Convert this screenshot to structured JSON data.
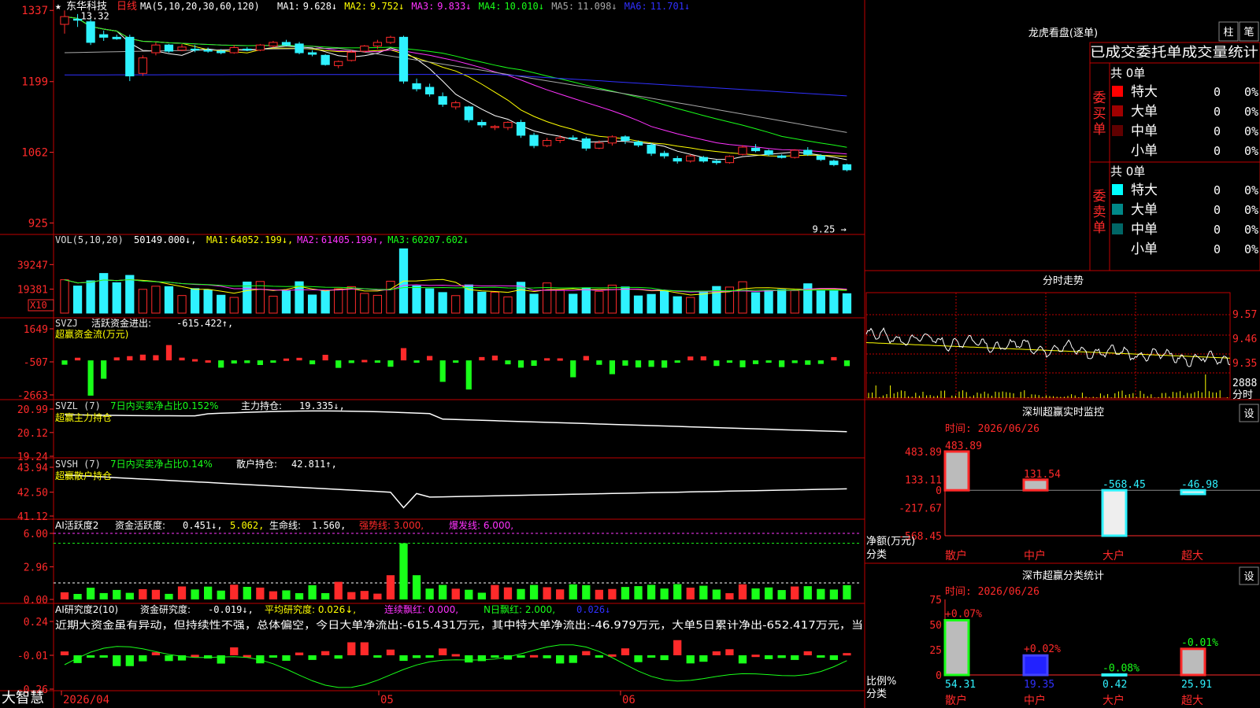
{
  "app": {
    "brand": "大智慧",
    "stock_name": "东华科技",
    "period": "日线",
    "star": "★"
  },
  "colors": {
    "up": "#ff2a2a",
    "down": "#2ff2ff",
    "green": "#19ff19",
    "yellow": "#ffff00",
    "magenta": "#ff33ff",
    "white": "#ffffff",
    "gray": "#a8a8a8",
    "blue": "#3030ff",
    "red_border": "#c00000"
  },
  "main_chart": {
    "yaxis": [
      "13.37",
      "11.99",
      "10.62",
      "9.25"
    ],
    "ylim": [
      9.15,
      13.45
    ],
    "ma_label": "MA(5,10,20,30,60,120)",
    "mas": [
      {
        "label": "MA1:",
        "value": "9.628↓",
        "color": "#ffffff"
      },
      {
        "label": "MA2:",
        "value": "9.752↓",
        "color": "#ffff00"
      },
      {
        "label": "MA3:",
        "value": "9.833↓",
        "color": "#ff33ff"
      },
      {
        "label": "MA4:",
        "value": "10.010↓",
        "color": "#19ff19"
      },
      {
        "label": "MA5:",
        "value": "11.098↓",
        "color": "#a8a8a8"
      },
      {
        "label": "MA6:",
        "value": "11.701↓",
        "color": "#3030ff"
      }
    ],
    "high_label": "13.32",
    "low_label": "9.25"
  },
  "vol_panel": {
    "title": "VOL(5,10,20)",
    "value": "50149.000↓,",
    "mas": [
      {
        "label": "MA1:",
        "value": "64052.199↓,",
        "color": "#ffff00"
      },
      {
        "label": "MA2:",
        "value": "61405.199↑,",
        "color": "#ff33ff"
      },
      {
        "label": "MA3:",
        "value": "60207.602↓",
        "color": "#19ff19"
      }
    ],
    "yaxis": [
      "39247",
      "19381"
    ],
    "unit": "X10"
  },
  "svzj_panel": {
    "title": "SVZJ",
    "label": "活跃资金进出:",
    "value": "-615.422↑,",
    "subtitle": "超赢资金流(万元)",
    "yaxis": [
      "1649",
      "-507",
      "-2663"
    ]
  },
  "svzl_panel": {
    "title": "SVZL (7)",
    "label1": "7日内买卖净占比0.152%",
    "label2": "主力持仓:",
    "value": "19.335↓,",
    "subtitle": "超赢主力持仓",
    "yaxis": [
      "20.99",
      "20.12",
      "19.24"
    ]
  },
  "svsh_panel": {
    "title": "SVSH (7)",
    "label1": "7日内买卖净占比0.14%",
    "label2": "散户持仓:",
    "value": "42.811↑,",
    "subtitle": "超赢散户持仓",
    "yaxis": [
      "43.94",
      "42.50",
      "41.12"
    ]
  },
  "ai_active_panel": {
    "title": "AI活跃度2",
    "label1": "资金活跃度:",
    "value1": "0.451↓,",
    "value2": "5.062,",
    "label3": "生命线:",
    "value3": "1.560,",
    "label4": "强势线: 3.000,",
    "label5": "爆发线: 6.000,",
    "yaxis": [
      "6.00",
      "2.96",
      "0.00"
    ]
  },
  "ai_research_panel": {
    "title": "AI研究度2(10)",
    "label1": "资金研究度:",
    "value1": "-0.019↓,",
    "label2": "平均研究度: 0.026↓,",
    "label3": "连续飘红: 0.000,",
    "label4": "N日飘红: 2.000,",
    "value4": "0.026↓",
    "commentary": "近期大资金虽有异动，但持续性不强，总体偏空，今日大单净流出:-615.431万元，其中特大单净流出:-46.979万元，大单5日累计净出-652.417万元，当",
    "yaxis": [
      "0.24",
      "-0.01",
      "-0.26"
    ]
  },
  "xaxis": [
    "2026/04",
    "05",
    "06"
  ],
  "dragon_tiger": {
    "title": "龙虎看盘(逐单)",
    "btn1": "柱",
    "btn2": "笔",
    "header": "已成交委托单成交量统计",
    "buy_label": "委买单",
    "sell_label": "委卖单",
    "buy_total": "共 0单",
    "sell_total": "共 0单",
    "buy_rows": [
      {
        "name": "特大",
        "count": "0",
        "pct": "0%",
        "color": "#ff0000"
      },
      {
        "name": "大单",
        "count": "0",
        "pct": "0%",
        "color": "#a00000"
      },
      {
        "name": "中单",
        "count": "0",
        "pct": "0%",
        "color": "#600000"
      },
      {
        "name": "小单",
        "count": "0",
        "pct": "0%",
        "color": "#000000"
      }
    ],
    "sell_rows": [
      {
        "name": "特大",
        "count": "0",
        "pct": "0%",
        "color": "#00ffff"
      },
      {
        "name": "大单",
        "count": "0",
        "pct": "0%",
        "color": "#008888"
      },
      {
        "name": "中单",
        "count": "0",
        "pct": "0%",
        "color": "#006666"
      },
      {
        "name": "小单",
        "count": "0",
        "pct": "0%",
        "color": "#000000"
      }
    ]
  },
  "intraday": {
    "title": "分时走势",
    "yaxis": [
      "9.57",
      "9.46",
      "9.35"
    ],
    "vol_label": "2888",
    "vol_unit": "分时"
  },
  "sz_monitor": {
    "title": "深圳超赢实时监控",
    "settings": "设",
    "time": "时间: 2026/06/26",
    "yaxis": [
      "483.89",
      "133.11",
      "0",
      "-217.67",
      "-568.45"
    ],
    "ylabel": "净额(万元)",
    "xlabel": "分类",
    "chart_data": {
      "type": "bar",
      "categories": [
        "散户",
        "中户",
        "大户",
        "超大"
      ],
      "values": [
        483.89,
        131.54,
        -568.45,
        -46.98
      ],
      "value_labels": [
        "483.89",
        "131.54",
        "-568.45",
        "-46.98"
      ],
      "ylim": [
        -568.45,
        483.89
      ]
    }
  },
  "sz_classify": {
    "title": "深市超赢分类统计",
    "settings": "设",
    "time": "时间: 2026/06/26",
    "yaxis": [
      "75",
      "50",
      "25",
      "0"
    ],
    "ylabel": "比例%",
    "xlabel": "分类",
    "chart_data": {
      "type": "bar",
      "categories": [
        "散户",
        "中户",
        "大户",
        "超大"
      ],
      "values": [
        54.31,
        19.35,
        0.42,
        25.91
      ],
      "value_labels": [
        "54.31",
        "19.35",
        "0.42",
        "25.91"
      ],
      "changes": [
        "+0.07%",
        "+0.02%",
        "-0.08%",
        "-0.01%"
      ],
      "ylim": [
        0,
        75
      ]
    }
  },
  "chart_data": {
    "type": "candlestick",
    "dates_ticks": [
      "2026/04",
      "05",
      "06"
    ],
    "ohlc": [
      [
        13.1,
        13.37,
        12.92,
        13.25
      ],
      [
        13.2,
        13.3,
        13.05,
        13.18
      ],
      [
        13.15,
        13.2,
        12.7,
        12.75
      ],
      [
        12.9,
        12.98,
        12.78,
        12.85
      ],
      [
        12.85,
        12.9,
        12.8,
        12.82
      ],
      [
        12.85,
        12.9,
        12.0,
        12.1
      ],
      [
        12.15,
        12.5,
        12.1,
        12.45
      ],
      [
        12.55,
        12.75,
        12.5,
        12.7
      ],
      [
        12.7,
        12.72,
        12.55,
        12.58
      ],
      [
        12.6,
        12.72,
        12.58,
        12.66
      ],
      [
        12.62,
        12.7,
        12.56,
        12.6
      ],
      [
        12.6,
        12.65,
        12.55,
        12.58
      ],
      [
        12.58,
        12.62,
        12.52,
        12.55
      ],
      [
        12.55,
        12.7,
        12.53,
        12.65
      ],
      [
        12.62,
        12.66,
        12.58,
        12.6
      ],
      [
        12.6,
        12.72,
        12.58,
        12.7
      ],
      [
        12.68,
        12.78,
        12.65,
        12.75
      ],
      [
        12.75,
        12.8,
        12.68,
        12.7
      ],
      [
        12.72,
        12.76,
        12.52,
        12.55
      ],
      [
        12.55,
        12.6,
        12.48,
        12.52
      ],
      [
        12.5,
        12.52,
        12.3,
        12.32
      ],
      [
        12.3,
        12.4,
        12.25,
        12.38
      ],
      [
        12.4,
        12.6,
        12.38,
        12.56
      ],
      [
        12.58,
        12.7,
        12.55,
        12.68
      ],
      [
        12.68,
        12.8,
        12.62,
        12.75
      ],
      [
        12.75,
        12.88,
        12.72,
        12.85
      ],
      [
        12.85,
        12.88,
        11.95,
        12.0
      ],
      [
        11.95,
        12.05,
        11.8,
        11.85
      ],
      [
        11.88,
        11.95,
        11.7,
        11.75
      ],
      [
        11.7,
        11.78,
        11.5,
        11.55
      ],
      [
        11.5,
        11.62,
        11.45,
        11.58
      ],
      [
        11.5,
        11.52,
        11.2,
        11.25
      ],
      [
        11.2,
        11.25,
        11.1,
        11.15
      ],
      [
        11.1,
        11.15,
        11.05,
        11.12
      ],
      [
        11.1,
        11.22,
        11.05,
        11.2
      ],
      [
        11.2,
        11.25,
        10.9,
        10.95
      ],
      [
        10.95,
        11.0,
        10.7,
        10.75
      ],
      [
        10.75,
        10.9,
        10.72,
        10.85
      ],
      [
        10.85,
        10.95,
        10.8,
        10.9
      ],
      [
        10.9,
        10.95,
        10.85,
        10.88
      ],
      [
        10.88,
        10.92,
        10.65,
        10.7
      ],
      [
        10.7,
        10.85,
        10.68,
        10.8
      ],
      [
        10.8,
        10.95,
        10.75,
        10.92
      ],
      [
        10.92,
        10.95,
        10.78,
        10.85
      ],
      [
        10.82,
        10.85,
        10.72,
        10.76
      ],
      [
        10.76,
        10.8,
        10.55,
        10.6
      ],
      [
        10.6,
        10.65,
        10.5,
        10.55
      ],
      [
        10.5,
        10.55,
        10.4,
        10.45
      ],
      [
        10.45,
        10.58,
        10.42,
        10.55
      ],
      [
        10.52,
        10.55,
        10.42,
        10.45
      ],
      [
        10.45,
        10.48,
        10.38,
        10.42
      ],
      [
        10.42,
        10.56,
        10.4,
        10.54
      ],
      [
        10.58,
        10.76,
        10.56,
        10.72
      ],
      [
        10.7,
        10.78,
        10.62,
        10.65
      ],
      [
        10.65,
        10.68,
        10.55,
        10.58
      ],
      [
        10.55,
        10.58,
        10.5,
        10.52
      ],
      [
        10.52,
        10.68,
        10.5,
        10.66
      ],
      [
        10.66,
        10.72,
        10.55,
        10.58
      ],
      [
        10.55,
        10.58,
        10.45,
        10.48
      ],
      [
        10.45,
        10.48,
        10.35,
        10.38
      ],
      [
        10.38,
        10.4,
        10.25,
        10.28
      ]
    ]
  }
}
